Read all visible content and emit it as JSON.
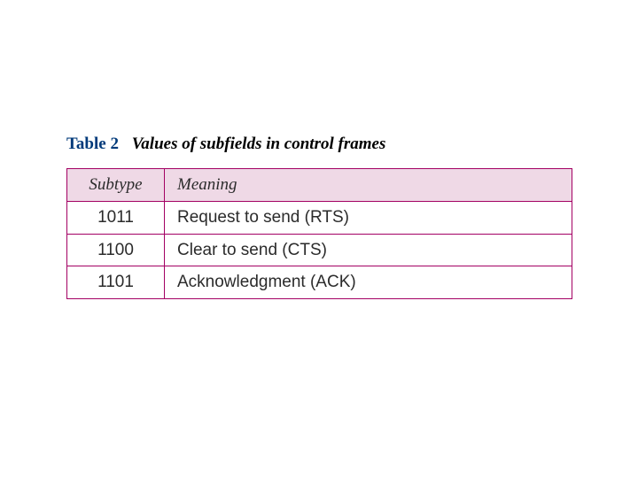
{
  "caption": {
    "label": "Table 2",
    "title": "Values of subfields in control frames"
  },
  "table": {
    "headers": [
      "Subtype",
      "Meaning"
    ],
    "rows": [
      {
        "subtype": "1011",
        "meaning": "Request to send (RTS)"
      },
      {
        "subtype": "1100",
        "meaning": "Clear to send (CTS)"
      },
      {
        "subtype": "1101",
        "meaning": "Acknowledgment (ACK)"
      }
    ]
  },
  "chart_data": {
    "type": "table",
    "title": "Values of subfields in control frames",
    "columns": [
      "Subtype",
      "Meaning"
    ],
    "rows": [
      [
        "1011",
        "Request to send (RTS)"
      ],
      [
        "1100",
        "Clear to send (CTS)"
      ],
      [
        "1101",
        "Acknowledgment (ACK)"
      ]
    ]
  }
}
